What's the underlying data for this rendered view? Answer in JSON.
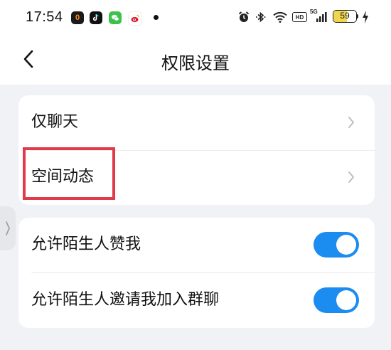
{
  "status_bar": {
    "time": "17:54",
    "app_icons": [
      {
        "name": "app-icon-1",
        "glyph": "0",
        "color": "#1a1a1a"
      },
      {
        "name": "tiktok-icon",
        "glyph": "♪",
        "color": "#111111"
      },
      {
        "name": "wechat-app-icon",
        "glyph": "◉",
        "color": "#3cc24a"
      },
      {
        "name": "weibo-icon",
        "glyph": "◕",
        "color": "#f5a623"
      }
    ],
    "hd_label": "HD",
    "signal_label": "5G",
    "battery_level": 59,
    "battery_text": "59"
  },
  "header": {
    "back_icon": "chevron-left-icon",
    "title": "权限设置"
  },
  "group1": {
    "items": [
      {
        "label": "仅聊天",
        "icon": "chevron-right-icon"
      },
      {
        "label": "空间动态",
        "icon": "chevron-right-icon"
      }
    ]
  },
  "group2": {
    "items": [
      {
        "label": "允许陌生人赞我",
        "toggle_on": true
      },
      {
        "label": "允许陌生人邀请我加入群聊",
        "toggle_on": true
      }
    ]
  },
  "colors": {
    "accent": "#1b8cf0",
    "highlight": "#e23a4d",
    "background": "#f1f2f5"
  }
}
